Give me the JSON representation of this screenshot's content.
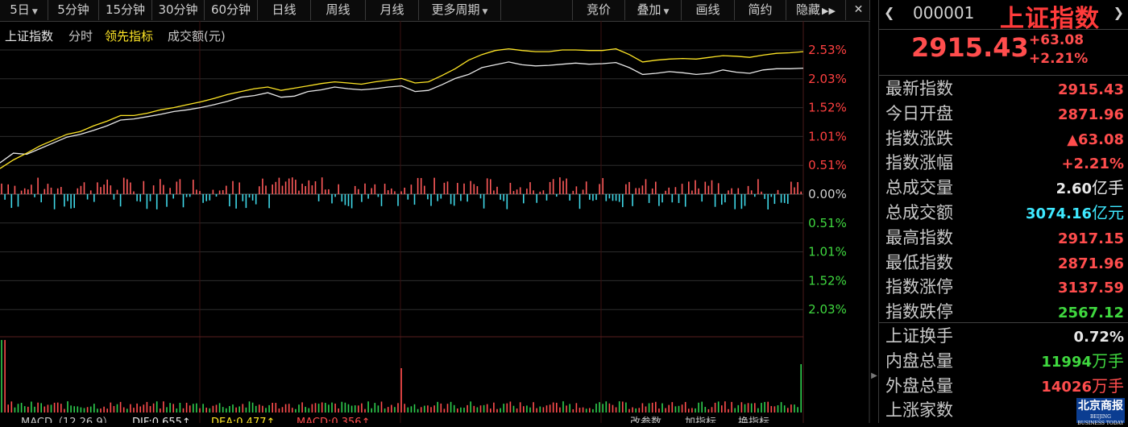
{
  "toolbar": {
    "periods": [
      {
        "label": "5日",
        "dropdown": true
      },
      {
        "label": "5分钟"
      },
      {
        "label": "15分钟"
      },
      {
        "label": "30分钟"
      },
      {
        "label": "60分钟"
      },
      {
        "label": "日线"
      },
      {
        "label": "周线"
      },
      {
        "label": "月线"
      },
      {
        "label": "更多周期",
        "dropdown": true
      }
    ],
    "right": [
      {
        "label": "竞价"
      },
      {
        "label": "叠加",
        "dropdown": true
      },
      {
        "label": "画线"
      },
      {
        "label": "简约"
      },
      {
        "label": "隐藏",
        "icon": "double-right-arrow-icon"
      }
    ]
  },
  "legend": {
    "name": "上证指数",
    "mode": "分时",
    "leading": "领先指标",
    "volume": "成交额(元)"
  },
  "axis_labels": {
    "pct": [
      "2.53%",
      "2.03%",
      "1.52%",
      "1.01%",
      "0.51%",
      "0.00%",
      "0.51%",
      "1.01%",
      "1.52%",
      "2.03%"
    ],
    "colors": [
      "#ff4040",
      "#ff4040",
      "#ff4040",
      "#ff4040",
      "#ff4040",
      "#d0d0d0",
      "#3fd83f",
      "#3fd83f",
      "#3fd83f",
      "#3fd83f"
    ]
  },
  "bottom": {
    "macd": "MACD（12,26,9）",
    "dif": "DIF:0.655↑",
    "dea": "DEA:0.477↑",
    "macdv": "MACD:0.356↑",
    "btn1": "改参数",
    "btn2": "加指标",
    "btn3": "换指标"
  },
  "header": {
    "code": "000001",
    "name": "上证指数",
    "price": "2915.43",
    "change": "+63.08",
    "change_pct": "+2.21%"
  },
  "stats": [
    {
      "label": "最新指数",
      "value": "2915.43",
      "unit": "",
      "color": "#ff4d4d"
    },
    {
      "label": "今日开盘",
      "value": "2871.96",
      "unit": "",
      "color": "#ff4d4d"
    },
    {
      "label": "指数涨跌",
      "value": "▲63.08",
      "unit": "",
      "color": "#ff4d4d"
    },
    {
      "label": "指数涨幅",
      "value": "+2.21%",
      "unit": "",
      "color": "#ff4d4d"
    },
    {
      "label": "总成交量",
      "value": "2.60",
      "unit": "亿手",
      "color": "#e8e8e8"
    },
    {
      "label": "总成交额",
      "value": "3074.16",
      "unit": "亿元",
      "color": "#3ee8ff"
    },
    {
      "label": "最高指数",
      "value": "2917.15",
      "unit": "",
      "color": "#ff4d4d"
    },
    {
      "label": "最低指数",
      "value": "2871.96",
      "unit": "",
      "color": "#ff4d4d"
    },
    {
      "label": "指数涨停",
      "value": "3137.59",
      "unit": "",
      "color": "#ff4d4d"
    },
    {
      "label": "指数跌停",
      "value": "2567.12",
      "unit": "",
      "color": "#3fd83f"
    }
  ],
  "stats2": [
    {
      "label": "上证换手",
      "value": "0.72%",
      "unit": "",
      "color": "#e8e8e8"
    },
    {
      "label": "内盘总量",
      "value": "11994",
      "unit": "万手",
      "color": "#3fd83f"
    },
    {
      "label": "外盘总量",
      "value": "14026",
      "unit": "万手",
      "color": "#ff4d4d"
    },
    {
      "label": "上涨家数",
      "value": "",
      "unit": "",
      "color": "#ff4d4d"
    }
  ],
  "watermark": {
    "main": "北京商报",
    "sub": "BEIJING BUSINESS TODAY"
  },
  "chart_data": {
    "type": "line",
    "x_days": 5,
    "ylim_pct": [
      -2.03,
      2.53
    ],
    "series": [
      {
        "name": "上证指数",
        "color": "#e8e8e8",
        "values": [
          0.55,
          0.72,
          0.7,
          0.8,
          0.9,
          1.0,
          1.05,
          1.12,
          1.2,
          1.3,
          1.32,
          1.36,
          1.4,
          1.45,
          1.48,
          1.52,
          1.57,
          1.63,
          1.7,
          1.73,
          1.78,
          1.7,
          1.72,
          1.8,
          1.83,
          1.88,
          1.85,
          1.83,
          1.85,
          1.88,
          1.9,
          1.8,
          1.82,
          1.92,
          2.03,
          2.1,
          2.22,
          2.27,
          2.32,
          2.27,
          2.25,
          2.26,
          2.28,
          2.3,
          2.28,
          2.29,
          2.31,
          2.22,
          2.1,
          2.12,
          2.15,
          2.13,
          2.1,
          2.12,
          2.18,
          2.14,
          2.12,
          2.18,
          2.2,
          2.2,
          2.21
        ]
      },
      {
        "name": "领先指标",
        "color": "#ffe626",
        "values": [
          0.45,
          0.6,
          0.72,
          0.85,
          0.95,
          1.05,
          1.1,
          1.2,
          1.28,
          1.38,
          1.38,
          1.42,
          1.48,
          1.52,
          1.57,
          1.62,
          1.68,
          1.75,
          1.8,
          1.85,
          1.88,
          1.82,
          1.86,
          1.9,
          1.94,
          1.97,
          1.95,
          1.93,
          1.97,
          2.0,
          2.03,
          1.95,
          1.97,
          2.08,
          2.2,
          2.35,
          2.45,
          2.52,
          2.55,
          2.52,
          2.5,
          2.5,
          2.53,
          2.53,
          2.52,
          2.52,
          2.55,
          2.45,
          2.32,
          2.35,
          2.37,
          2.38,
          2.37,
          2.4,
          2.43,
          2.42,
          2.4,
          2.44,
          2.47,
          2.48,
          2.5
        ]
      }
    ]
  }
}
